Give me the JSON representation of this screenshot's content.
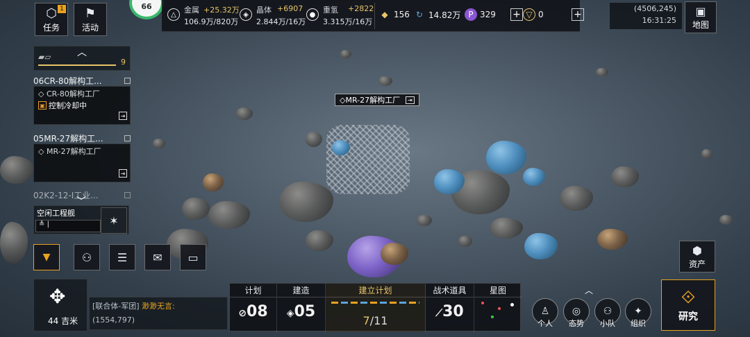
{
  "top_left": {
    "task_button": {
      "label": "任务",
      "badge": "1"
    },
    "activity_button": {
      "label": "活动"
    },
    "level_badge": "66"
  },
  "resources": [
    {
      "icon": "metal-icon",
      "name": "金属",
      "delta": "+25.32万",
      "amount": "106.9万/820万"
    },
    {
      "icon": "crystal-icon",
      "name": "晶体",
      "delta": "+6907",
      "amount": "2.844万/16万"
    },
    {
      "icon": "heavy-hydrogen-icon",
      "name": "重氢",
      "delta": "+2822",
      "amount": "3.315万/16万"
    }
  ],
  "currencies": {
    "rank": "156",
    "energy": "14.82万",
    "premium": "329",
    "gold": "0"
  },
  "top_right": {
    "coordinates": "(4506,245)",
    "time": "16:31:25",
    "map_label": "地图"
  },
  "fleet_summary": {
    "value": "9"
  },
  "tasks": [
    {
      "title": "06CR-80解构工...",
      "name": "CR-80解构工厂",
      "status": "控制冷却中"
    },
    {
      "title": "05MR-27解构工...",
      "name": "MR-27解构工厂",
      "status": ""
    },
    {
      "title": "02K2-12-I工业..."
    }
  ],
  "idle_ship": {
    "label": "空闲工程舰",
    "input": "|"
  },
  "map_label_station": "MR-27解构工厂",
  "location": {
    "distance": "44 吉米",
    "channel": "[联合体-军团]",
    "sender": "渺渺无言:",
    "coords": "(1554,797)"
  },
  "plan_bar": {
    "plan": {
      "label": "计划",
      "value": "08"
    },
    "build": {
      "label": "建造",
      "value": "05"
    },
    "establish": {
      "label": "建立计划",
      "current": "7",
      "total": "/11"
    },
    "tactical": {
      "label": "战术道具",
      "value": "30"
    },
    "starmap": {
      "label": "星图"
    }
  },
  "right_actions": {
    "assets": "资产",
    "personal": "个人",
    "situation": "态势",
    "squad": "小队",
    "organization": "组织",
    "research": "研究"
  },
  "colors": {
    "accent": "#e9c46a",
    "warn": "#e89a2a",
    "panel": "#12151a"
  }
}
